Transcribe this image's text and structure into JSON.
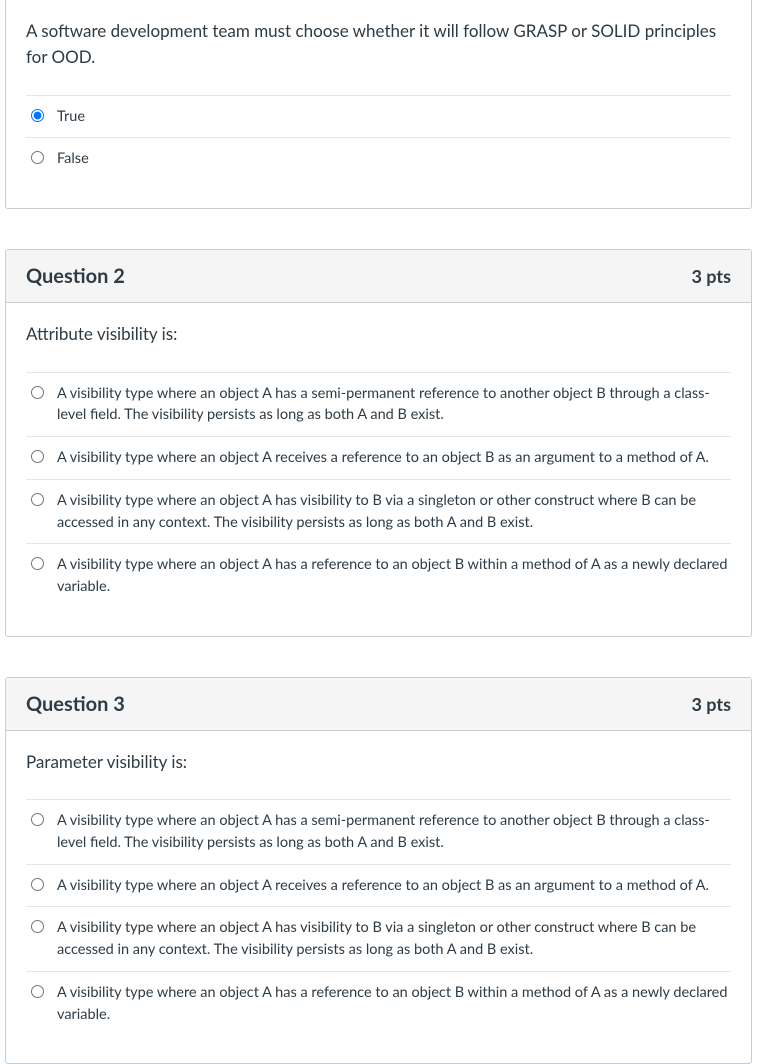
{
  "q1": {
    "prompt": "A software development team must choose whether it will follow GRASP or SOLID principles for OOD.",
    "options": [
      "True",
      "False"
    ],
    "selected": 0
  },
  "q2": {
    "title": "Question 2",
    "points": "3 pts",
    "prompt": "Attribute visibility is:",
    "options": [
      "A visibility type where an object A has a semi-permanent reference to another object B through a class-level field. The visibility persists as long as both A and B exist.",
      "A visibility type where an object A receives a reference to an object B as an argument to a method of A.",
      "A visibility type where an object A has visibility to B via a singleton or other construct where B can be accessed in any context. The visibility persists as long as both A and B exist.",
      "A visibility type where an object A has a reference to an object B within a method of A as a newly declared variable."
    ]
  },
  "q3": {
    "title": "Question 3",
    "points": "3 pts",
    "prompt": "Parameter visibility is:",
    "options": [
      "A visibility type where an object A has a semi-permanent reference to another object B through a class-level field. The visibility persists as long as both A and B exist.",
      "A visibility type where an object A receives a reference to an object B as an argument to a method of A.",
      "A visibility type where an object A has visibility to B via a singleton or other construct where B can be accessed in any context. The visibility persists as long as both A and B exist.",
      "A visibility type where an object A has a reference to an object B within a method of A as a newly declared variable."
    ]
  }
}
